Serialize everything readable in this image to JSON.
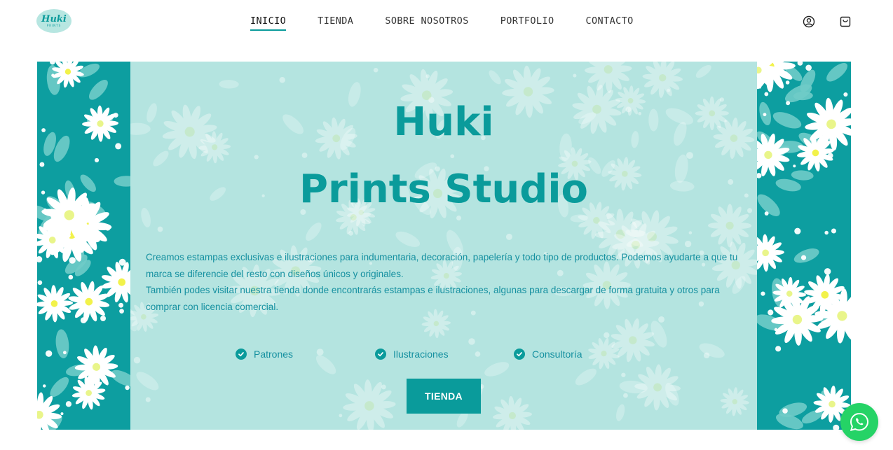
{
  "brand": {
    "logo_text": "Huki",
    "logo_subtext": "PRINTS"
  },
  "nav": {
    "items": [
      {
        "label": "INICIO",
        "active": true
      },
      {
        "label": "TIENDA",
        "active": false
      },
      {
        "label": "SOBRE NOSOTROS",
        "active": false
      },
      {
        "label": "PORTFOLIO",
        "active": false
      },
      {
        "label": "CONTACTO",
        "active": false
      }
    ]
  },
  "header_icons": [
    "account-icon",
    "cart-icon"
  ],
  "hero": {
    "title_line1": "Huki",
    "title_line2": "Prints Studio",
    "paragraph1": "Creamos estampas exclusivas e ilustraciones para indumentaria, decoración, papelería y todo tipo de productos. Podemos ayudarte a que tu marca se diferencie del resto con diseños únicos y originales.",
    "paragraph2": "También podes visitar nuestra tienda donde encontrarás estampas e ilustraciones, algunas para descargar de forma gratuita y otros para comprar con licencia comercial.",
    "features": [
      "Patrones",
      "Ilustraciones",
      "Consultoría"
    ],
    "cta_label": "TIENDA"
  },
  "floating": {
    "icon": "whatsapp-icon"
  },
  "colors": {
    "accent": "#0a9b9b",
    "hero_side_bg": "#0d9ea0",
    "hero_center_bg": "#b4e4e0",
    "text_teal": "#1590a0",
    "whatsapp": "#25d366"
  }
}
